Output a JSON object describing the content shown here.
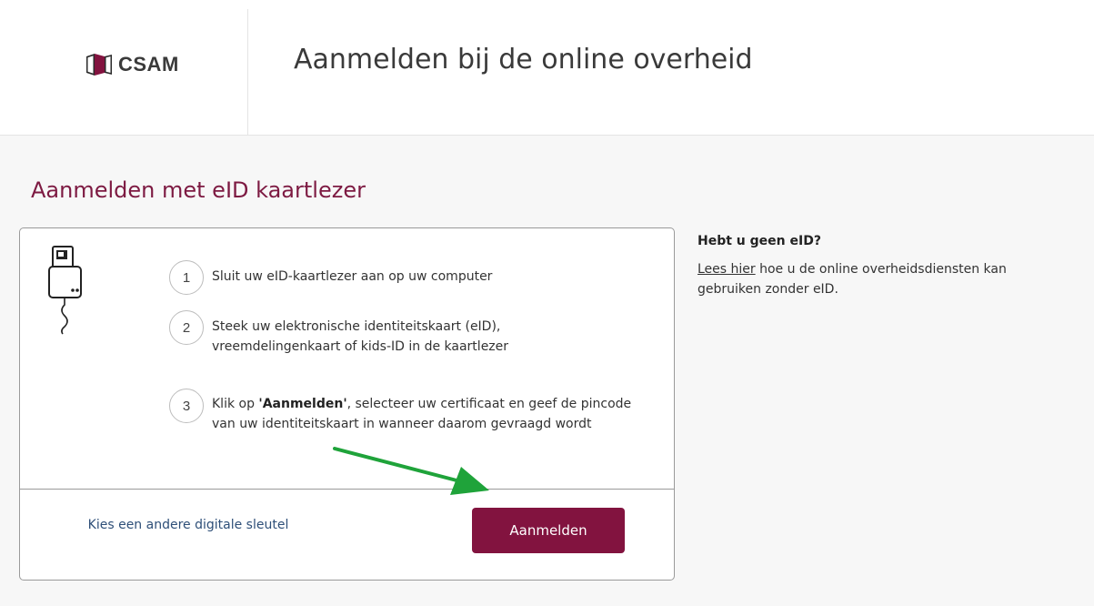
{
  "header": {
    "logo_text": "CSAM",
    "title": "Aanmelden bij de online overheid"
  },
  "main": {
    "heading": "Aanmelden met eID kaartlezer",
    "steps": [
      {
        "number": "1",
        "text": "Sluit uw eID-kaartlezer aan op uw computer"
      },
      {
        "number": "2",
        "text": "Steek uw elektronische identiteitskaart (eID), vreemdelingenkaart of kids-ID in de kaartlezer"
      },
      {
        "number": "3",
        "text_before": "Klik op ",
        "text_bold": "'Aanmelden'",
        "text_after": ", selecteer uw certificaat en geef de pincode van uw identiteitskaart in wanneer daarom gevraagd wordt"
      }
    ],
    "alt_key_link": "Kies een andere digitale sleutel",
    "login_button": "Aanmelden"
  },
  "sidebar": {
    "title": "Hebt u geen eID?",
    "link_text": "Lees hier",
    "text": " hoe u de online overheidsdiensten kan gebruiken zonder eID."
  },
  "colors": {
    "brand": "#82133f",
    "heading": "#7d1a42",
    "annotation_arrow": "#1fa33a"
  },
  "icons": {
    "logo": "csam-logo-icon",
    "reader": "card-reader-icon",
    "arrow": "green-arrow-icon"
  }
}
